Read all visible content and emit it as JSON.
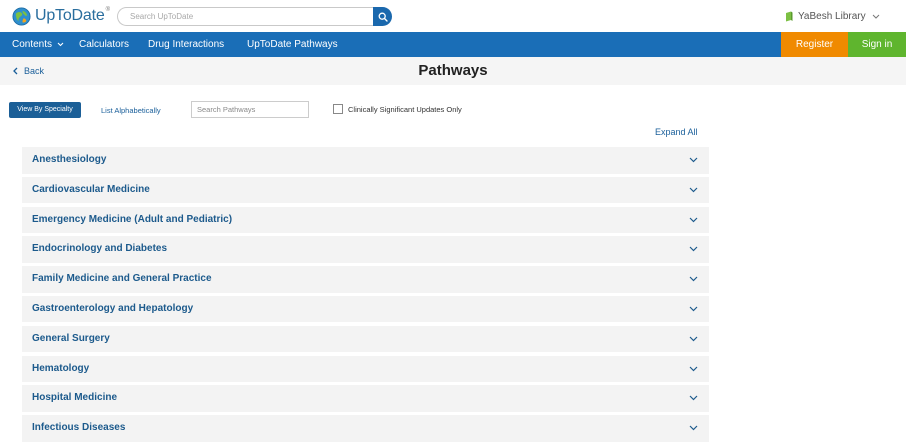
{
  "header": {
    "logo_text": "UpToDate",
    "logo_mark": "®",
    "search_placeholder": "Search UpToDate",
    "library_label": "YaBesh Library"
  },
  "nav": {
    "contents": "Contents",
    "calculators": "Calculators",
    "drug_interactions": "Drug Interactions",
    "pathways": "UpToDate Pathways",
    "register": "Register",
    "sign_in": "Sign in"
  },
  "title_bar": {
    "back": "Back",
    "title": "Pathways"
  },
  "controls": {
    "view_by_specialty": "View By Specialty",
    "list_alphabetically": "List Alphabetically",
    "search_pathways_placeholder": "Search Pathways",
    "clinically_significant_label": "Clinically Significant Updates Only",
    "clinically_significant_checked": false,
    "expand_all": "Expand All"
  },
  "specialties": [
    "Anesthesiology",
    "Cardiovascular Medicine",
    "Emergency Medicine (Adult and Pediatric)",
    "Endocrinology and Diabetes",
    "Family Medicine and General Practice",
    "Gastroenterology and Hepatology",
    "General Surgery",
    "Hematology",
    "Hospital Medicine",
    "Infectious Diseases"
  ],
  "colors": {
    "nav_bg": "#1a6eb7",
    "register_bg": "#f08a00",
    "sign_in_bg": "#5fb52e",
    "specialty_btn_bg": "#1b5f97",
    "link": "#1a5f9a"
  },
  "icons": {
    "logo": "globe-logo-icon",
    "search": "search-icon",
    "library": "library-icon",
    "dropdown": "chevron-down-icon",
    "back": "chevron-left-icon"
  }
}
